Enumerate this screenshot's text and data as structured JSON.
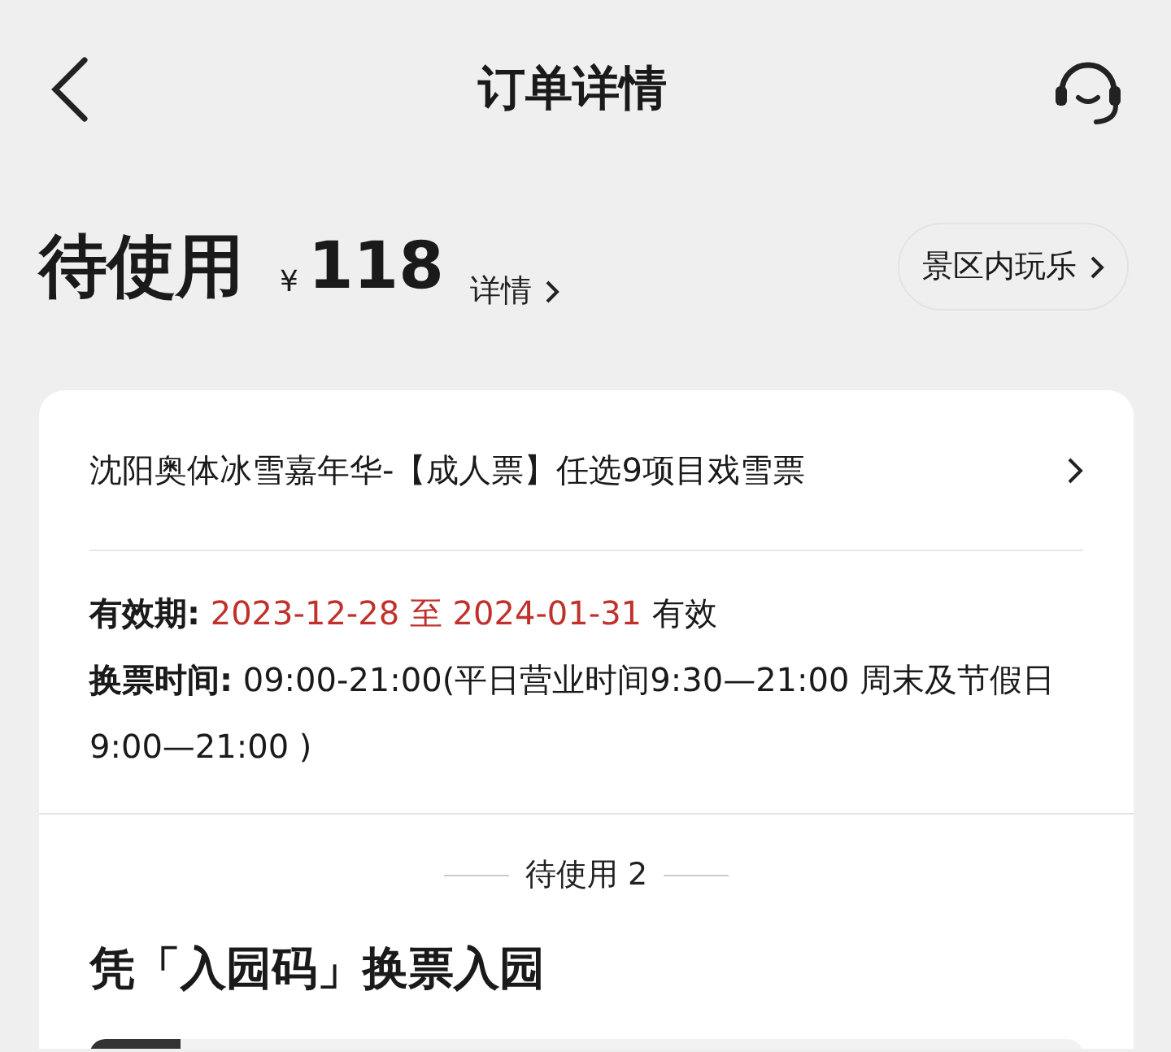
{
  "header": {
    "title": "订单详情"
  },
  "status": {
    "label": "待使用",
    "currency": "¥",
    "amount": "118",
    "details_link": "详情",
    "tag": "景区内玩乐"
  },
  "product": {
    "name": "沈阳奥体冰雪嘉年华-【成人票】任选9项目戏雪票"
  },
  "validity": {
    "label": "有效期:",
    "dates": "2023-12-28 至 2024-01-31",
    "suffix": "有效"
  },
  "exchange": {
    "text": "**换票时间:** 09:00-21:00(平日营业时间9:30—21:00  周末及节假日9:00—21:00 )"
  },
  "tickets": {
    "divider_label": "待使用 2",
    "heading": "凭「入园码」换票入园"
  }
}
